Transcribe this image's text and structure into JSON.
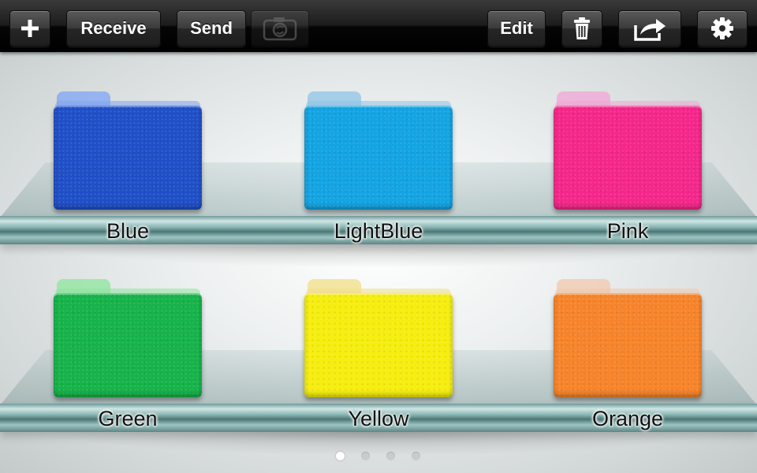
{
  "toolbar": {
    "add_icon": "plus-icon",
    "receive_label": "Receive",
    "send_label": "Send",
    "camera_icon": "camera-icon",
    "edit_label": "Edit",
    "trash_icon": "trash-icon",
    "share_icon": "share-icon",
    "settings_icon": "gear-icon"
  },
  "folders": [
    {
      "label": "Blue",
      "color": "#1f4fc8",
      "tab_color": "#7fa5f4"
    },
    {
      "label": "LightBlue",
      "color": "#13a4e3",
      "tab_color": "#8fc4e8"
    },
    {
      "label": "Pink",
      "color": "#f5278a",
      "tab_color": "#f0a6d6"
    },
    {
      "label": "Green",
      "color": "#16b34a",
      "tab_color": "#8ee69d"
    },
    {
      "label": "Yellow",
      "color": "#f6ee0e",
      "tab_color": "#f1df86"
    },
    {
      "label": "Orange",
      "color": "#f7842a",
      "tab_color": "#f1c8ad"
    }
  ],
  "pagination": {
    "current_page": 1,
    "total_pages": 4
  }
}
